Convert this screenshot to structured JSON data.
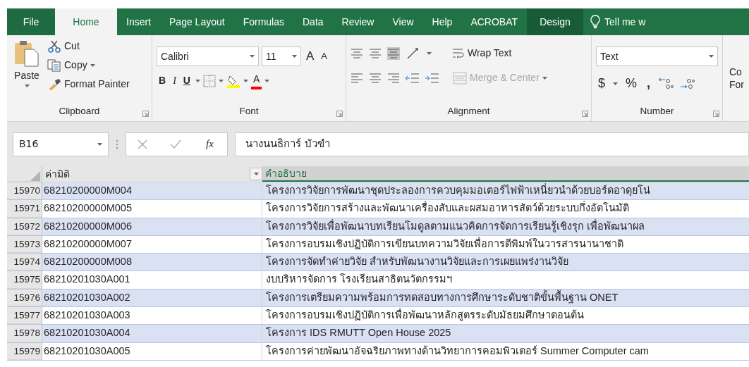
{
  "ribbon_tabs": [
    {
      "label": "File",
      "selected": false,
      "contextual": false
    },
    {
      "label": "Home",
      "selected": true,
      "contextual": false
    },
    {
      "label": "Insert",
      "selected": false,
      "contextual": false
    },
    {
      "label": "Page Layout",
      "selected": false,
      "contextual": false
    },
    {
      "label": "Formulas",
      "selected": false,
      "contextual": false
    },
    {
      "label": "Data",
      "selected": false,
      "contextual": false
    },
    {
      "label": "Review",
      "selected": false,
      "contextual": false
    },
    {
      "label": "View",
      "selected": false,
      "contextual": false
    },
    {
      "label": "Help",
      "selected": false,
      "contextual": false
    },
    {
      "label": "ACROBAT",
      "selected": false,
      "contextual": false
    },
    {
      "label": "Design",
      "selected": false,
      "contextual": true
    }
  ],
  "tell_me": "Tell me w",
  "clipboard": {
    "paste": "Paste",
    "cut": "Cut",
    "copy": "Copy",
    "format_painter": "Format Painter",
    "label": "Clipboard"
  },
  "font": {
    "name": "Calibri",
    "size": "11",
    "grow": "A",
    "shrink": "A",
    "bold": "B",
    "italic": "I",
    "underline": "U",
    "color_letter": "A",
    "label": "Font"
  },
  "alignment": {
    "wrap_text": "Wrap Text",
    "merge_center": "Merge & Center",
    "merge_disabled": true,
    "label": "Alignment"
  },
  "number": {
    "format": "Text",
    "currency": "$",
    "percent": "%",
    "comma": ",",
    "label": "Number"
  },
  "styles_partial": [
    "Co",
    "For"
  ],
  "formula_bar": {
    "name_box": "B16",
    "fx": "fx",
    "content": "นางนนธิการ์ บัวขำ"
  },
  "table": {
    "columns": [
      {
        "label": "ค่ามิติ",
        "selected": false,
        "filter": true
      },
      {
        "label": "คำอธิบาย",
        "selected": true,
        "filter": false
      }
    ],
    "rows": [
      {
        "row": "15970",
        "code": "68210200000M004",
        "description": "โครงการวิจัยการพัฒนาชุดประลองการควบคุมมอเตอร์ไฟฟ้าเหนี่ยวนำด้วยบอร์ดอาดุยโน่"
      },
      {
        "row": "15971",
        "code": "68210200000M005",
        "description": "โครงการวิจัยการสร้างและพัฒนาเครื่องสับและผสมอาหารสัตว์ด้วยระบบกึ่งอัตโนมัติ"
      },
      {
        "row": "15972",
        "code": "68210200000M006",
        "description": "โครงการวิจัยเพื่อพัฒนาบทเรียนโมดูลตามแนวคิดการจัดการเรียนรู้เชิงรุก เพื่อพัฒนาผล"
      },
      {
        "row": "15973",
        "code": "68210200000M007",
        "description": "โครงการอบรมเชิงปฏิบัติการเขียนบทความวิจัยเพื่อการตีพิมพ์ในวารสารนานาชาติ"
      },
      {
        "row": "15974",
        "code": "68210200000M008",
        "description": "โครงการจัดทำค่ายวิจัย สำหรับพัฒนางานวิจัยและการเผยแพร่งานวิจัย"
      },
      {
        "row": "15975",
        "code": "68210201030A001",
        "description": "งบบริหารจัดการ โรงเรียนสาธิตนวัตกรรมฯ"
      },
      {
        "row": "15976",
        "code": "68210201030A002",
        "description": "โครงการเตรียมความพร้อมการทดสอบทางการศึกษาระดับชาติขั้นพื้นฐาน ONET"
      },
      {
        "row": "15977",
        "code": "68210201030A003",
        "description": "โครงการอบรมเชิงปฏิบัติการเพื่อพัฒนาหลักสูตรระดับมัธยมศึกษาตอนต้น"
      },
      {
        "row": "15978",
        "code": "68210201030A004",
        "description": "โครงการ IDS RMUTT Open House 2025"
      },
      {
        "row": "15979",
        "code": "68210201030A005",
        "description": "โครงการค่ายพัฒนาอัจฉริยภาพทางด้านวิทยาการคอมพิวเตอร์ Summer Computer cam"
      }
    ]
  }
}
